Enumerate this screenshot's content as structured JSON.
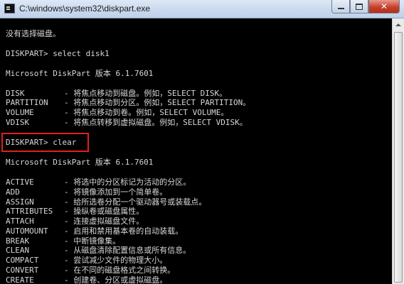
{
  "window": {
    "title": "C:\\windows\\system32\\diskpart.exe",
    "buttons": {
      "minimize": "minimize",
      "maximize": "maximize",
      "close": "✕"
    }
  },
  "console": {
    "no_disk": "没有选择磁盘。",
    "prompt_select": "DISKPART> select disk1",
    "version_1": "Microsoft DiskPart 版本 6.1.7601",
    "focus_help": [
      {
        "cmd": "DISK",
        "desc": "- 将焦点移动到磁盘。例如，SELECT DISK。"
      },
      {
        "cmd": "PARTITION",
        "desc": "- 将焦点移动到分区。例如，SELECT PARTITION。"
      },
      {
        "cmd": "VOLUME",
        "desc": "- 将焦点移动到卷。例如，SELECT VOLUME。"
      },
      {
        "cmd": "VDISK",
        "desc": "- 将焦点转移到虚拟磁盘。例如，SELECT VDISK。"
      }
    ],
    "prompt_clear": "DISKPART> clear",
    "version_2": "Microsoft DiskPart 版本 6.1.7601",
    "commands": [
      {
        "cmd": "ACTIVE",
        "desc": "- 将选中的分区标记为活动的分区。"
      },
      {
        "cmd": "ADD",
        "desc": "- 将镜像添加到一个简单卷。"
      },
      {
        "cmd": "ASSIGN",
        "desc": "- 给所选卷分配一个驱动器号或装载点。"
      },
      {
        "cmd": "ATTRIBUTES",
        "desc": "- 操纵卷或磁盘属性。"
      },
      {
        "cmd": "ATTACH",
        "desc": "- 连接虚拟磁盘文件。"
      },
      {
        "cmd": "AUTOMOUNT",
        "desc": "- 启用和禁用基本卷的自动装载。"
      },
      {
        "cmd": "BREAK",
        "desc": "- 中断镜像集。"
      },
      {
        "cmd": "CLEAN",
        "desc": "- 从磁盘清除配置信息或所有信息。"
      },
      {
        "cmd": "COMPACT",
        "desc": "- 尝试减少文件的物理大小。"
      },
      {
        "cmd": "CONVERT",
        "desc": "- 在不同的磁盘格式之间转换。"
      },
      {
        "cmd": "CREATE",
        "desc": "- 创建卷、分区或虚拟磁盘。"
      }
    ]
  }
}
